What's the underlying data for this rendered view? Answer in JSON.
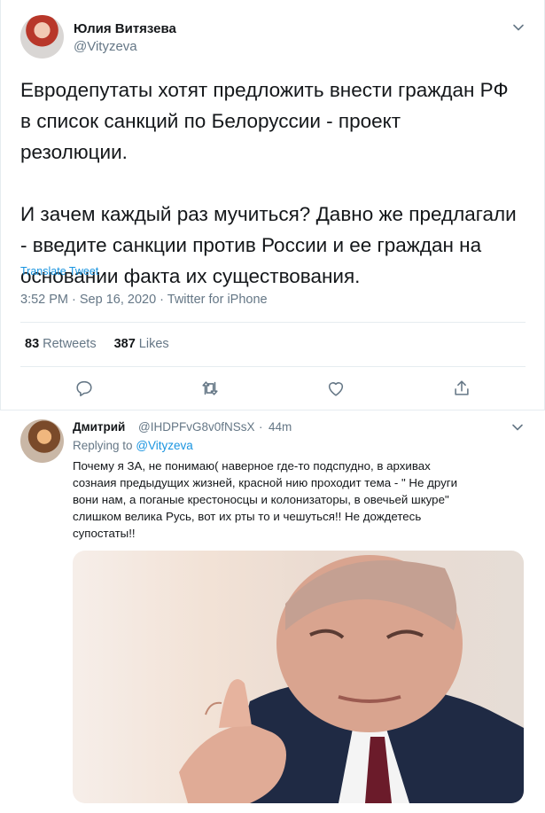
{
  "main_tweet": {
    "display_name": "Юлия Витязева",
    "handle": "@Vityzeva",
    "text": "Евродепутаты хотят предложить внести граждан РФ\nв список санкций по Белоруссии - проект\nрезолюции.\n\nИ зачем каждый раз мучиться? Давно же предлагали\n- введите санкции против России и ее граждан на\nосновании факта их существования.",
    "translate_label": "Translate Tweet",
    "meta": "3:52 PM · Sep 16, 2020 · Twitter for iPhone",
    "retweets_count": "83",
    "retweets_label": "Retweets",
    "likes_count": "387",
    "likes_label": "Likes"
  },
  "reply_tweet": {
    "display_name": "Дмитрий",
    "handle": "@IHDPFvG8v0fNSsX",
    "dot": "·",
    "time": "44m",
    "replying_prefix": "Replying to",
    "replying_to": "@Vityzeva",
    "text": "Почему я ЗА,  не понимаю( наверное где-то подспудно, в архивах\nсознаия предыдущих жизней, красной нию проходит тема - \" Не други\nвони нам, а поганые крестоносцы и колонизаторы,  в овечьей шкуре\"\nслишком велика Русь, вот их рты то и чешуться!! Не дождетесь\nсупостаты!!"
  },
  "icons": {
    "reply": "reply-icon",
    "retweet": "retweet-icon",
    "like": "heart-icon",
    "share": "share-icon",
    "more": "chevron-down-icon"
  },
  "colors": {
    "link": "#1b95e0",
    "secondary_text": "#657786",
    "divider": "#e6ecf0"
  }
}
